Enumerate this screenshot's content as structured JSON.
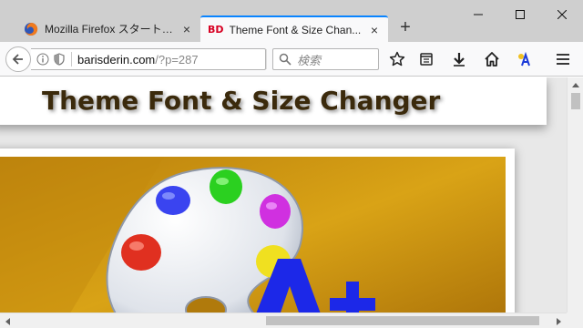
{
  "tabs": [
    {
      "label": "Mozilla Firefox スタートページ",
      "icon": "firefox-icon",
      "active": false
    },
    {
      "label": "Theme Font & Size Chan...",
      "icon": "bd-favicon",
      "badge": "BD",
      "active": true
    }
  ],
  "new_tab_label": "+",
  "tab_close_glyph": "×",
  "window_controls": {
    "minimize": "minimize-icon",
    "maximize": "maximize-icon",
    "close": "close-icon"
  },
  "url": {
    "host": "barisderin.com",
    "path": "/?p=287"
  },
  "search": {
    "placeholder": "検索"
  },
  "toolbar_icons": [
    "bookmark-star-icon",
    "reading-list-icon",
    "download-icon",
    "home-icon",
    "translate-icon",
    "menu-icon"
  ],
  "page": {
    "title": "Theme Font & Size Changer"
  },
  "colors": {
    "accent": "#0a84ff",
    "title_text": "#3b2a0c",
    "image_bg": "#c99410",
    "paint_red": "#e03020",
    "paint_blue": "#2a3be8",
    "paint_green": "#2bd020",
    "paint_magenta": "#d030e0",
    "paint_yellow": "#f0e020"
  }
}
